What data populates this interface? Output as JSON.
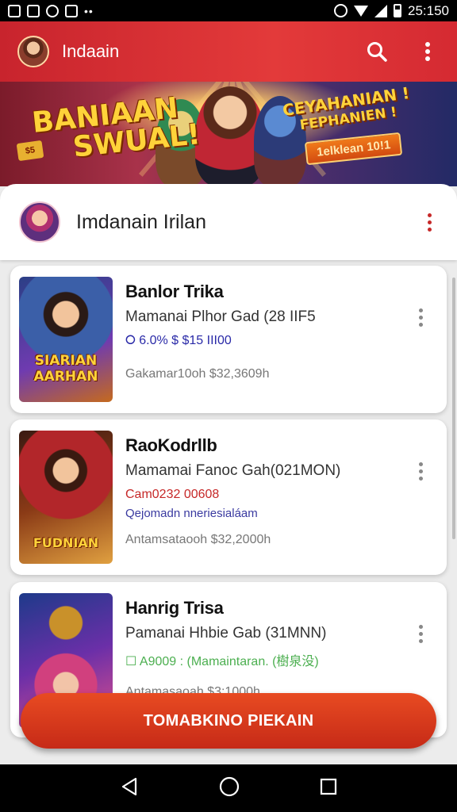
{
  "status_bar": {
    "time": "25:150"
  },
  "app_bar": {
    "title": "Indaain"
  },
  "banner": {
    "left_line1": "BANIAAN",
    "left_line2": "SWUAL!",
    "right_line1": "CEYAHANIAN !",
    "right_line2": "FEPHANIEN !",
    "cta": "1elklean 10!1"
  },
  "header": {
    "title": "Imdanain Irilan"
  },
  "cards": [
    {
      "title": "Banlor Trika",
      "subtitle": "Mamanai Plhor Gad (28 IIF5",
      "tag": "⭘ 6.0% $ $15 III00",
      "tag_color": "#2a2aa8",
      "extra": "",
      "footer": "Gakamar10oh  $32,3609h",
      "thumb_label_1": "SIARIAN",
      "thumb_label_2": "AARHAN"
    },
    {
      "title": "RaoKodrllb",
      "subtitle": "Mamamai Fanoc Gah(021MON)",
      "tag": "Cam0232 00608",
      "tag_color": "#c62828",
      "extra": "Qejomadn nneriesialáam",
      "footer": "Antamsataooh  $32,2000h",
      "thumb_label_1": "FUDNIAN",
      "thumb_label_2": ""
    },
    {
      "title": "Hanrig Trisa",
      "subtitle": "Pamanai Hhbie Gab (31MNN)",
      "tag": "☐ A9009 : (Mamaintaran. (樹泉没)",
      "tag_color": "#4caf50",
      "extra": "",
      "footer": "Antamasaoah  $3:1000h",
      "thumb_label_1": "",
      "thumb_label_2": ""
    }
  ],
  "fab": {
    "label": "TOMABKINO PIEKAIN"
  }
}
